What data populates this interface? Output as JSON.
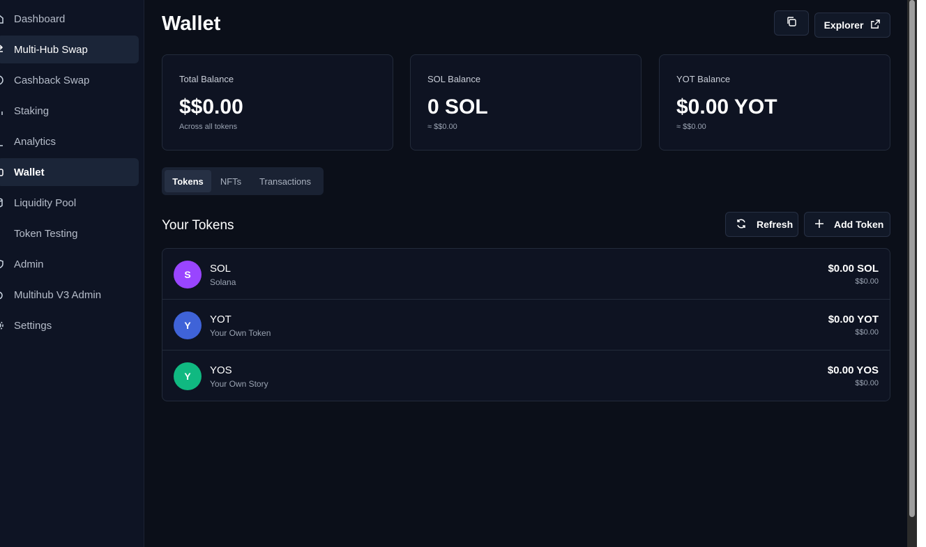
{
  "sidebar": {
    "items": [
      {
        "label": "Dashboard",
        "icon": "home-icon"
      },
      {
        "label": "Multi-Hub Swap",
        "icon": "swap-icon"
      },
      {
        "label": "Cashback Swap",
        "icon": "cashback-icon"
      },
      {
        "label": "Staking",
        "icon": "staking-icon"
      },
      {
        "label": "Analytics",
        "icon": "chart-icon"
      },
      {
        "label": "Wallet",
        "icon": "wallet-icon"
      },
      {
        "label": "Liquidity Pool",
        "icon": "pool-icon"
      },
      {
        "label": "Token Testing",
        "icon": "test-icon"
      },
      {
        "label": "Admin",
        "icon": "shield-icon"
      },
      {
        "label": "Multihub V3 Admin",
        "icon": "admin-icon"
      },
      {
        "label": "Settings",
        "icon": "gear-icon"
      }
    ],
    "active": "Wallet"
  },
  "header": {
    "title": "Wallet",
    "explorer_label": "Explorer"
  },
  "cards": [
    {
      "label": "Total Balance",
      "value": "$$0.00",
      "sub": "Across all tokens"
    },
    {
      "label": "SOL Balance",
      "value": "0 SOL",
      "sub": "≈ $$0.00"
    },
    {
      "label": "YOT Balance",
      "value": "$0.00 YOT",
      "sub": "≈ $$0.00"
    }
  ],
  "tabs": [
    {
      "label": "Tokens"
    },
    {
      "label": "NFTs"
    },
    {
      "label": "Transactions"
    }
  ],
  "tokens_section": {
    "title": "Your Tokens",
    "refresh_label": "Refresh",
    "add_label": "Add Token"
  },
  "tokens": [
    {
      "letter": "S",
      "symbol": "SOL",
      "name": "Solana",
      "balance": "$0.00 SOL",
      "usd": "$$0.00",
      "color": "#9945ff"
    },
    {
      "letter": "Y",
      "symbol": "YOT",
      "name": "Your Own Token",
      "balance": "$0.00 YOT",
      "usd": "$$0.00",
      "color": "#3f63d8"
    },
    {
      "letter": "Y",
      "symbol": "YOS",
      "name": "Your Own Story",
      "balance": "$0.00 YOS",
      "usd": "$$0.00",
      "color": "#10b981"
    }
  ]
}
